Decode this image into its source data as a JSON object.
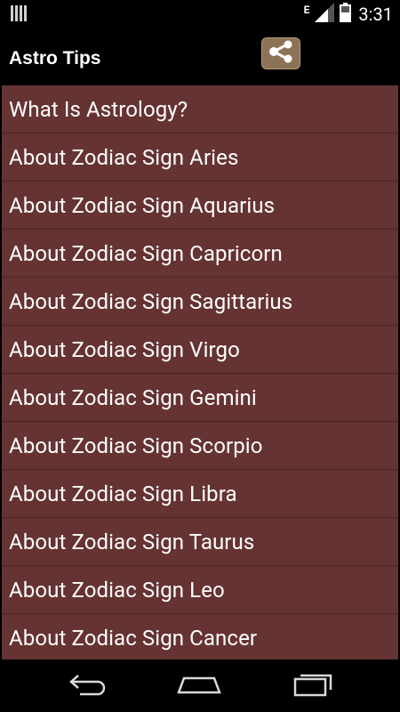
{
  "status_bar": {
    "network_type": "E",
    "time": "3:31",
    "icons": [
      "notification-bars-icon",
      "signal-icon",
      "battery-icon"
    ]
  },
  "action_bar": {
    "title": "Astro Tips",
    "share_icon": "share-icon"
  },
  "topics": [
    "What Is Astrology?",
    "About Zodiac Sign Aries",
    "About Zodiac Sign Aquarius",
    "About Zodiac Sign Capricorn",
    "About Zodiac Sign Sagittarius",
    "About Zodiac Sign Virgo",
    "About Zodiac Sign Gemini",
    "About Zodiac Sign Scorpio",
    "About Zodiac Sign Libra",
    "About Zodiac Sign Taurus",
    "About Zodiac Sign Leo",
    "About Zodiac Sign Cancer"
  ],
  "nav_bar": {
    "icons": [
      "back-icon",
      "home-icon",
      "recent-apps-icon"
    ]
  },
  "colors": {
    "list_background": "#663333",
    "divider": "#4a2323",
    "share_button": "#8c7256",
    "bars": "#000000",
    "text": "#ffffff"
  }
}
